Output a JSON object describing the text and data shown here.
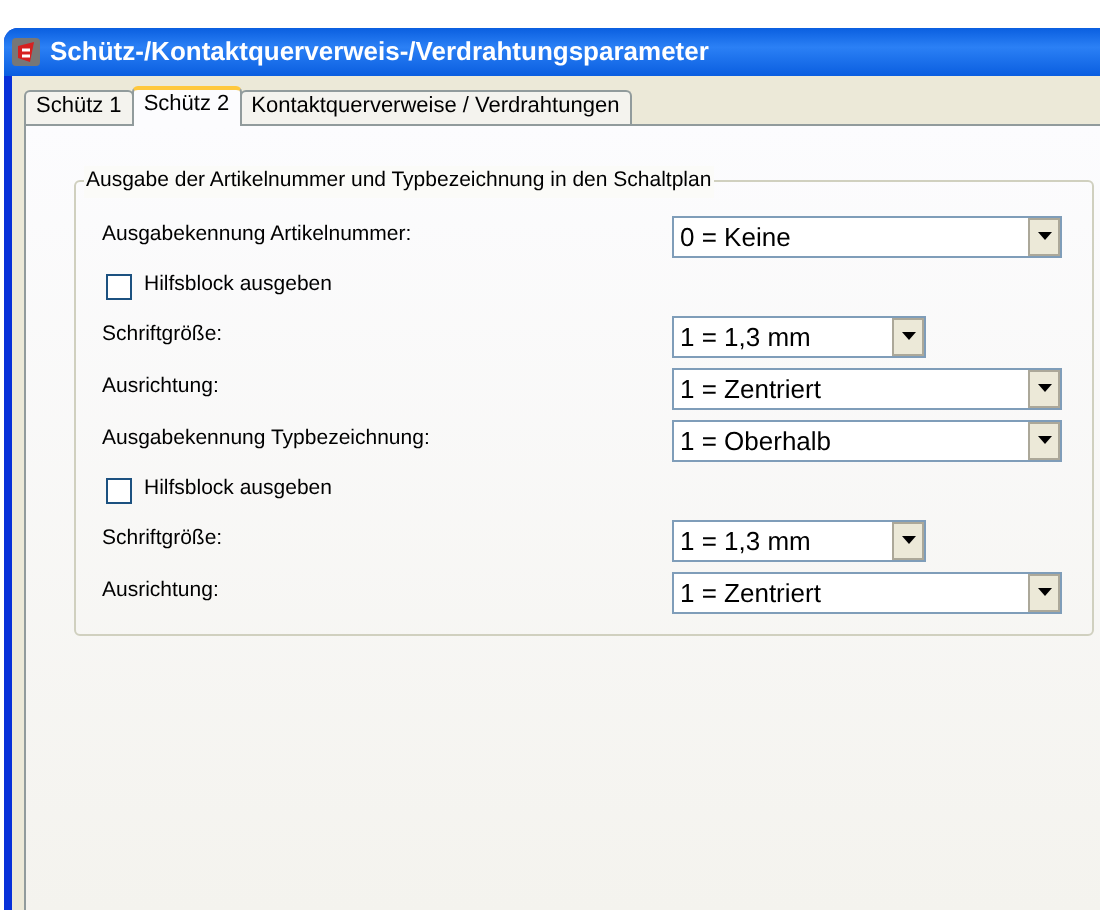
{
  "window": {
    "title": "Schütz-/Kontaktquerverweis-/Verdrahtungsparameter"
  },
  "tabs": [
    {
      "label": "Schütz 1",
      "selected": false
    },
    {
      "label": "Schütz 2",
      "selected": true
    },
    {
      "label": "Kontaktquerverweise / Verdrahtungen",
      "selected": false
    }
  ],
  "group": {
    "title": "Ausgabe der Artikelnummer und Typbezeichnung in den Schaltplan",
    "rows": [
      {
        "kind": "combo",
        "label": "Ausgabekennung Artikelnummer:",
        "value": "0 = Keine"
      },
      {
        "kind": "checkbox",
        "label": "Hilfsblock ausgeben",
        "checked": false
      },
      {
        "kind": "short_combo",
        "label": "Schriftgröße:",
        "value": "1 = 1,3 mm"
      },
      {
        "kind": "combo",
        "label": "Ausrichtung:",
        "value": "1 = Zentriert"
      },
      {
        "kind": "combo",
        "label": "Ausgabekennung Typbezeichnung:",
        "value": "1 = Oberhalb"
      },
      {
        "kind": "checkbox",
        "label": "Hilfsblock ausgeben",
        "checked": false
      },
      {
        "kind": "short_combo",
        "label": "Schriftgröße:",
        "value": "1 = 1,3 mm"
      },
      {
        "kind": "combo",
        "label": "Ausrichtung:",
        "value": "1 = Zentriert"
      }
    ]
  }
}
